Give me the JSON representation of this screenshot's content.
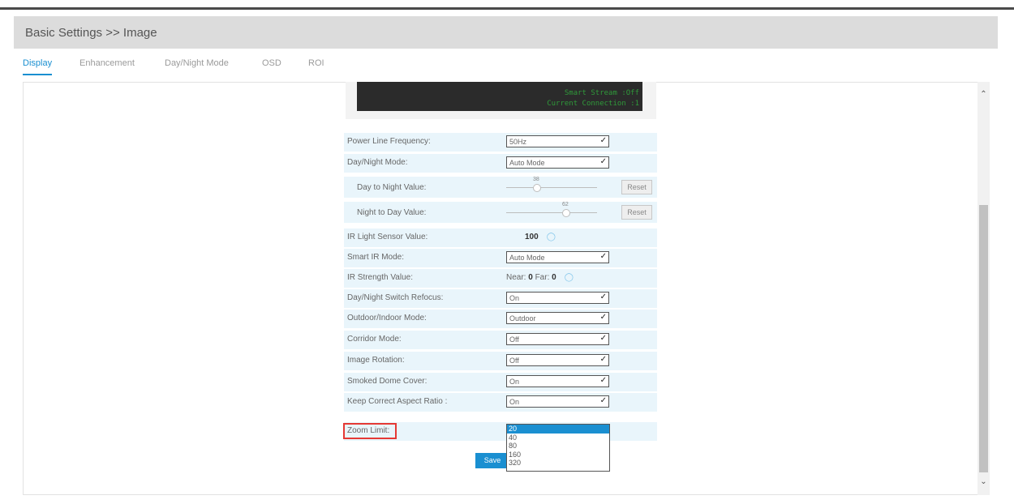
{
  "header": {
    "breadcrumb": "Basic Settings >> Image"
  },
  "tabs": [
    {
      "label": "Display",
      "active": true
    },
    {
      "label": "Enhancement",
      "active": false
    },
    {
      "label": "Day/Night Mode",
      "active": false
    },
    {
      "label": "OSD",
      "active": false
    },
    {
      "label": "ROI",
      "active": false
    }
  ],
  "preview": {
    "osd_line1": "Smart Stream :Off",
    "osd_line2": "Current Connection :1"
  },
  "settings": {
    "power_line_frequency": {
      "label": "Power Line Frequency:",
      "value": "50Hz"
    },
    "day_night_mode": {
      "label": "Day/Night Mode:",
      "value": "Auto Mode"
    },
    "day_to_night": {
      "label": "Day to Night Value:",
      "value": "38",
      "reset": "Reset"
    },
    "night_to_day": {
      "label": "Night to Day Value:",
      "value": "62",
      "reset": "Reset"
    },
    "ir_light_sensor": {
      "label": "IR Light Sensor Value:",
      "value": "100"
    },
    "smart_ir_mode": {
      "label": "Smart IR Mode:",
      "value": "Auto Mode"
    },
    "ir_strength": {
      "label": "IR Strength Value:",
      "near_label": "Near:",
      "near": "0",
      "far_label": "Far:",
      "far": "0"
    },
    "refocus": {
      "label": "Day/Night Switch Refocus:",
      "value": "On"
    },
    "outdoor_indoor": {
      "label": "Outdoor/Indoor Mode:",
      "value": "Outdoor"
    },
    "corridor": {
      "label": "Corridor Mode:",
      "value": "Off"
    },
    "rotation": {
      "label": "Image Rotation:",
      "value": "Off"
    },
    "smoked_dome": {
      "label": "Smoked Dome Cover:",
      "value": "On"
    },
    "aspect_ratio": {
      "label": "Keep Correct Aspect Ratio :",
      "value": "On"
    },
    "zoom_limit": {
      "label": "Zoom Limit:",
      "options": [
        "20",
        "40",
        "80",
        "160",
        "320"
      ],
      "selected": "20"
    }
  },
  "save_label": "Save",
  "colors": {
    "accent": "#1a8fd1",
    "row_bg": "#e9f5fb",
    "highlight": "#e53935"
  },
  "icons": {
    "scroll_up": "chevron-up-icon",
    "scroll_down": "chevron-down-icon",
    "select_arrow": "chevron-down-icon"
  }
}
